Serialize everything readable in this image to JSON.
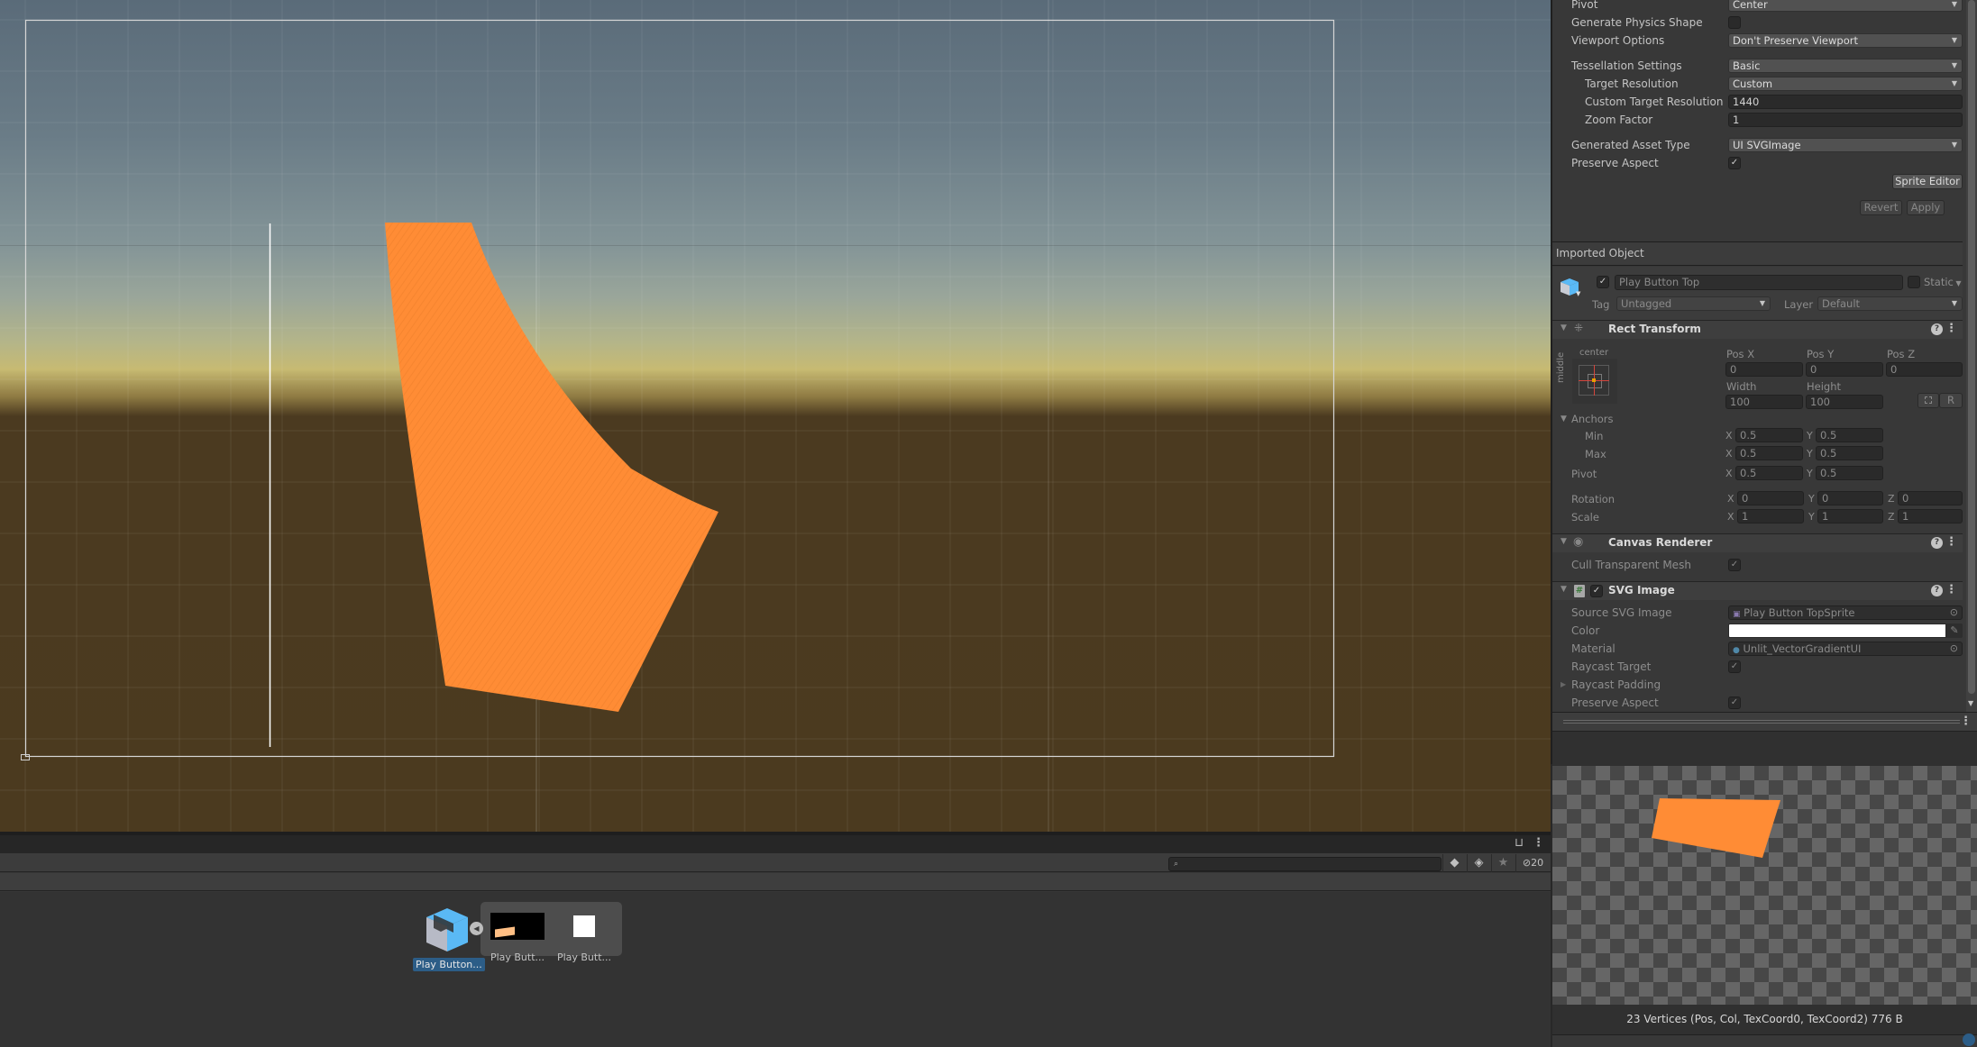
{
  "colors": {
    "shape_fill": "#ff8c35",
    "selection_blue": "#2c5d87",
    "panel_bg": "#383838",
    "pivot_orange": "#e6a000",
    "anchor_red": "#d4453c"
  },
  "scene": {
    "shape_label": "Play Button Top (orange SVG shape)"
  },
  "project": {
    "search": {
      "value": "",
      "placeholder": ""
    },
    "lock_icon": "lock-open-icon",
    "menu_icon": "kebab-menu-icon",
    "filter_buttons": [
      {
        "name": "filter-by-type",
        "icon": "shapes-icon"
      },
      {
        "name": "filter-by-label",
        "icon": "tag-icon"
      },
      {
        "name": "favorites",
        "icon": "star-icon"
      }
    ],
    "hidden_count": "20",
    "assets": [
      {
        "label": "Play Button...",
        "icon": "prefab-box-icon",
        "selected": true
      },
      {
        "label": "Play Butt...",
        "icon": "sprite-thumbnail",
        "selected": false
      },
      {
        "label": "Play Butt...",
        "icon": "white-square-thumbnail",
        "selected": false
      }
    ]
  },
  "inspector": {
    "import_settings": [
      {
        "label": "Pivot",
        "type": "dropdown",
        "value": "Center"
      },
      {
        "label": "Generate Physics Shape",
        "type": "checkbox",
        "checked": false
      },
      {
        "label": "Viewport Options",
        "type": "dropdown",
        "value": "Don't Preserve Viewport"
      },
      {
        "label": "Tessellation Settings",
        "type": "dropdown",
        "value": "Basic"
      },
      {
        "label": "Target Resolution",
        "type": "dropdown",
        "value": "Custom"
      },
      {
        "label": "Custom Target Resolution",
        "type": "text",
        "value": "1440"
      },
      {
        "label": "Zoom Factor",
        "type": "text",
        "value": "1"
      },
      {
        "label": "Generated Asset Type",
        "type": "dropdown",
        "value": "UI SVGImage"
      },
      {
        "label": "Preserve Aspect",
        "type": "checkbox",
        "checked": true
      }
    ],
    "sprite_editor_label": "Sprite Editor",
    "revert_label": "Revert",
    "apply_label": "Apply",
    "imported_object_title": "Imported Object",
    "gameobject": {
      "active": true,
      "name": "Play Button Top",
      "static_label": "Static",
      "static": false,
      "tag_label": "Tag",
      "tag": "Untagged",
      "layer_label": "Layer",
      "layer": "Default"
    },
    "rect_transform": {
      "title": "Rect Transform",
      "anchor_preset_h": "center",
      "anchor_preset_v": "middle",
      "pos_x_label": "Pos X",
      "pos_x": "0",
      "pos_y_label": "Pos Y",
      "pos_y": "0",
      "pos_z_label": "Pos Z",
      "pos_z": "0",
      "width_label": "Width",
      "width": "100",
      "height_label": "Height",
      "height": "100",
      "blueprint_label": "",
      "raw_label": "R",
      "anchors_label": "Anchors",
      "min_label": "Min",
      "min_x": "0.5",
      "min_y": "0.5",
      "max_label": "Max",
      "max_x": "0.5",
      "max_y": "0.5",
      "pivot_label": "Pivot",
      "pivot_x": "0.5",
      "pivot_y": "0.5",
      "rotation_label": "Rotation",
      "rot_x": "0",
      "rot_y": "0",
      "rot_z": "0",
      "scale_label": "Scale",
      "scale_x": "1",
      "scale_y": "1",
      "scale_z": "1",
      "x": "X",
      "y": "Y",
      "z": "Z"
    },
    "canvas_renderer": {
      "title": "Canvas Renderer",
      "cull_label": "Cull Transparent Mesh",
      "cull": true
    },
    "svg_image": {
      "title": "SVG Image",
      "enabled": true,
      "source_label": "Source SVG Image",
      "source_value": "Play Button TopSprite",
      "color_label": "Color",
      "color_value": "#ffffff",
      "material_label": "Material",
      "material_value": "Unlit_VectorGradientUI",
      "raycast_target_label": "Raycast Target",
      "raycast_target": true,
      "raycast_padding_label": "Raycast Padding",
      "preserve_aspect_label": "Preserve Aspect",
      "preserve_aspect": true
    },
    "preview_info": "23 Vertices (Pos, Col, TexCoord0, TexCoord2) 776 B"
  },
  "glyphs": {
    "check": "✓",
    "dropdown_arrow": "▼",
    "fold_open": "▼",
    "fold_closed": "▶",
    "help": "?",
    "kebab": "⋮",
    "search": "⌕",
    "star": "★"
  }
}
